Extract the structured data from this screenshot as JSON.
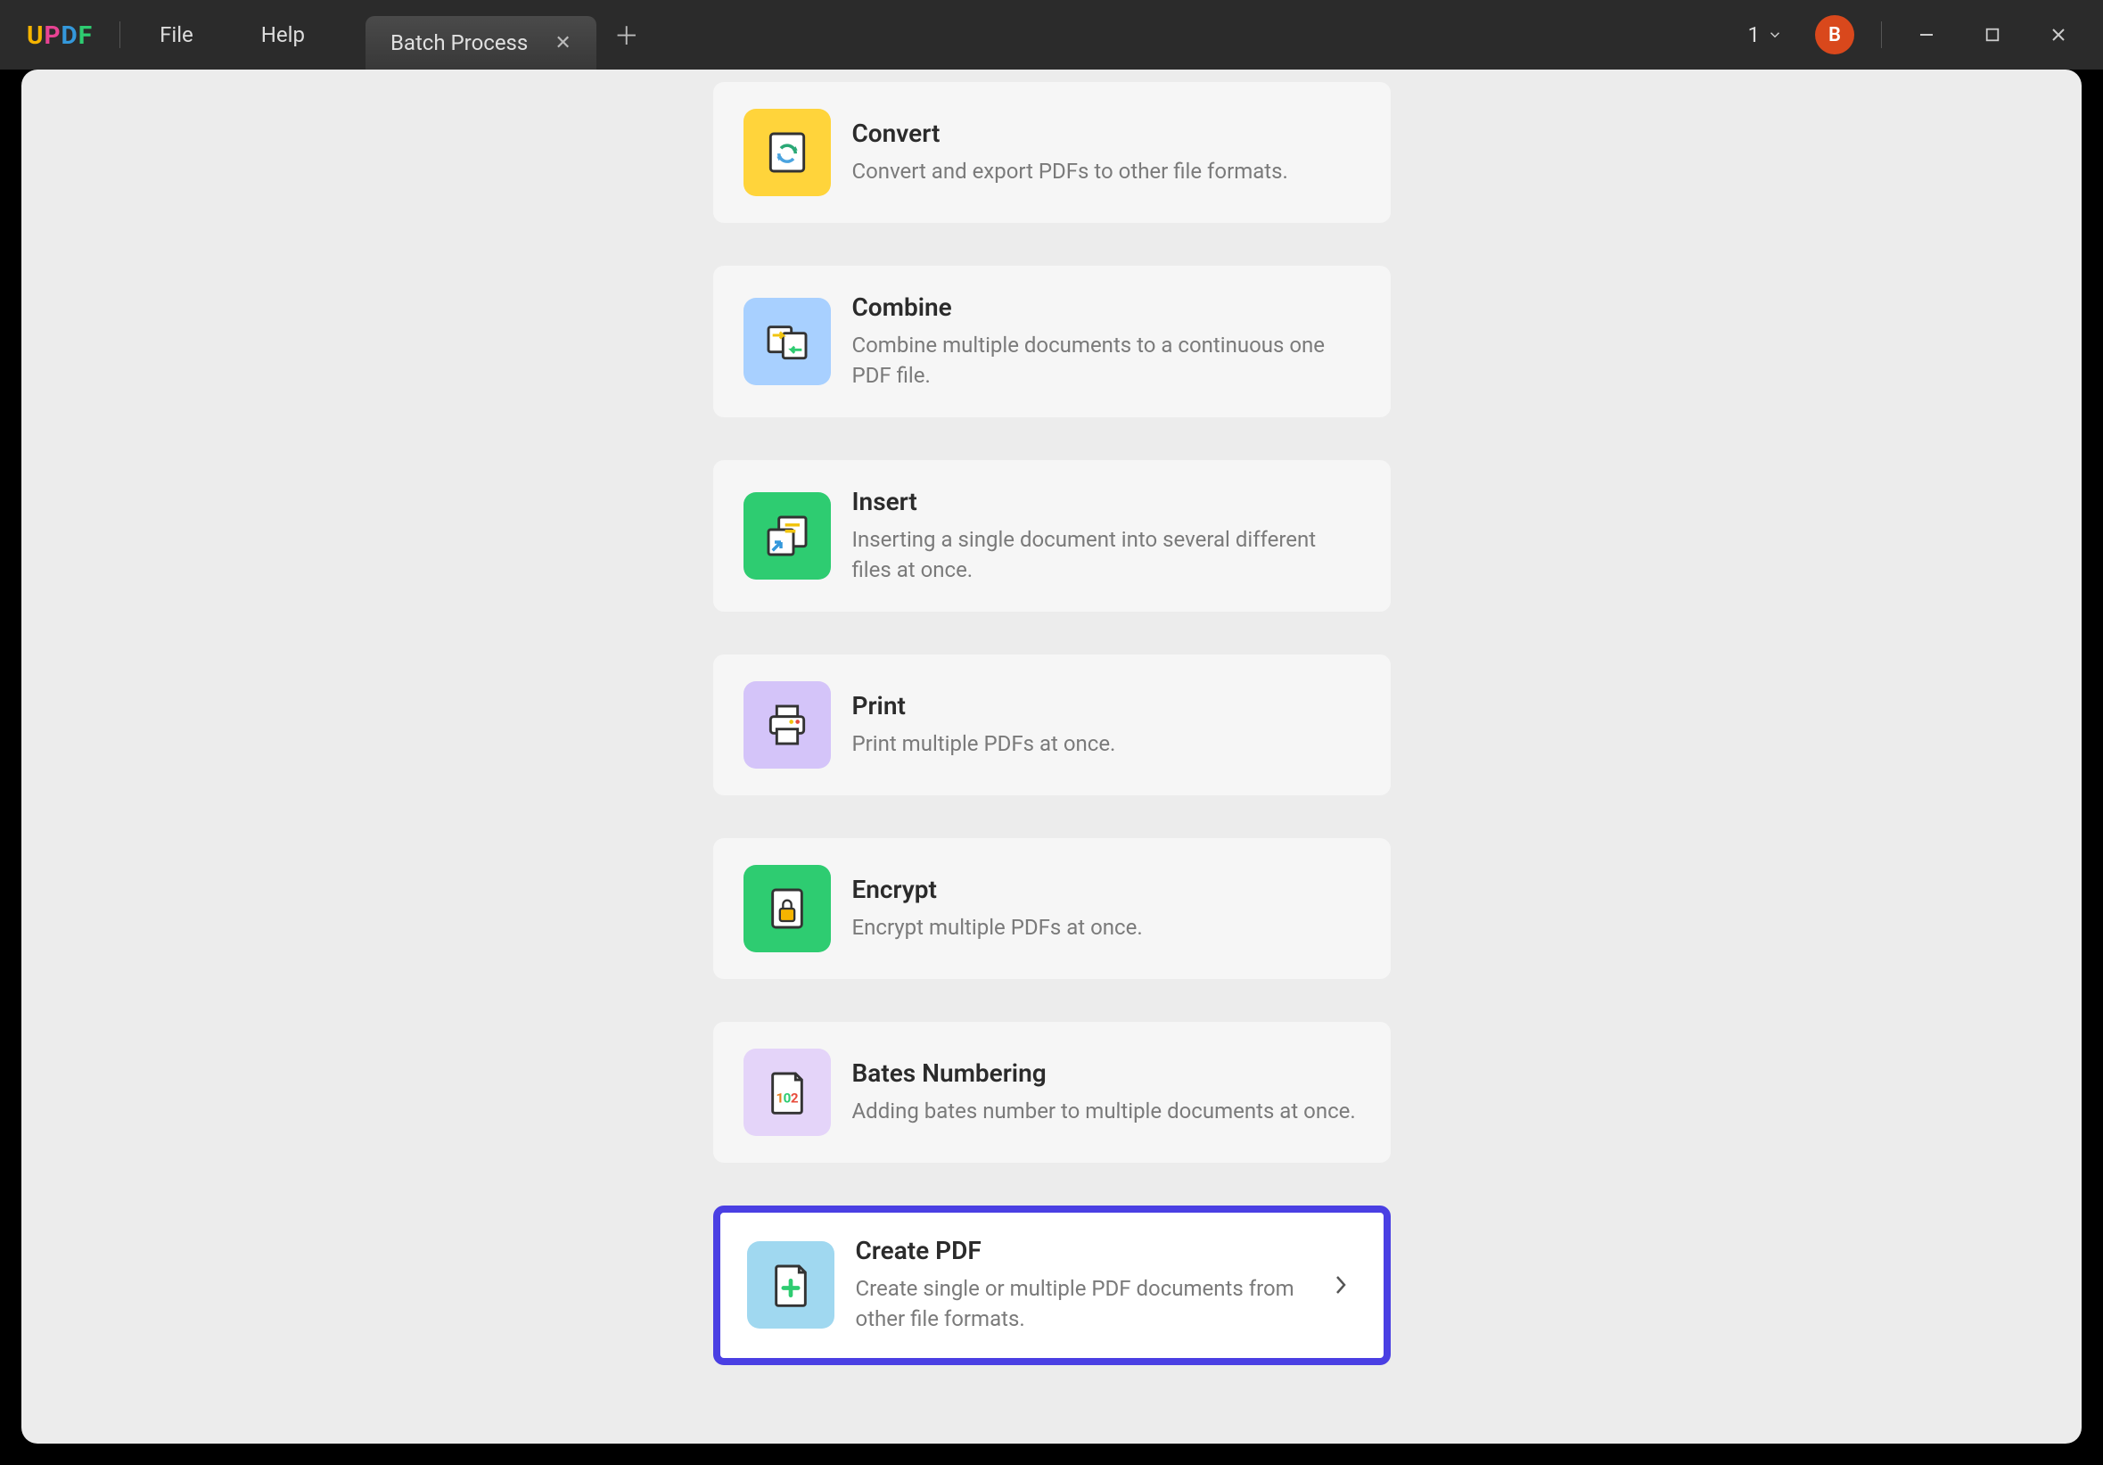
{
  "menu": {
    "file": "File",
    "help": "Help"
  },
  "tab": {
    "title": "Batch Process"
  },
  "header": {
    "count": "1",
    "avatar_letter": "B"
  },
  "cards": [
    {
      "title": "Convert",
      "desc": "Convert and export PDFs to other file formats."
    },
    {
      "title": "Combine",
      "desc": "Combine multiple documents to a continuous one PDF file."
    },
    {
      "title": "Insert",
      "desc": "Inserting a single document into several different files at once."
    },
    {
      "title": "Print",
      "desc": "Print multiple PDFs at once."
    },
    {
      "title": "Encrypt",
      "desc": "Encrypt multiple PDFs at once."
    },
    {
      "title": "Bates Numbering",
      "desc": "Adding bates number to multiple documents at once."
    },
    {
      "title": "Create PDF",
      "desc": "Create single or multiple PDF documents from other file formats."
    }
  ]
}
